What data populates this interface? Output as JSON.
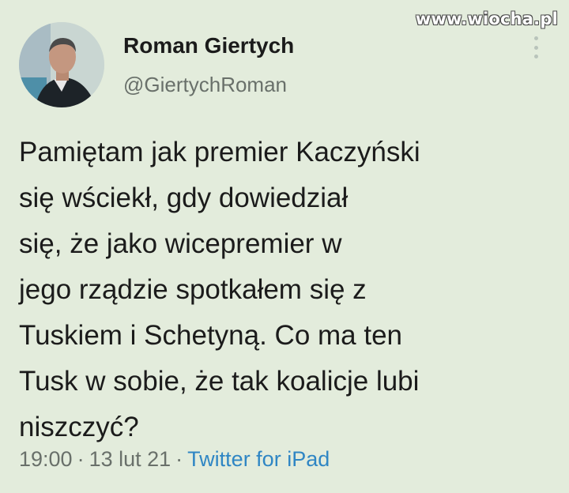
{
  "watermark": "www.wiocha.pl",
  "author": {
    "name": "Roman Giertych",
    "handle": "@GiertychRoman"
  },
  "tweet": {
    "lines": [
      "Pamiętam jak premier Kaczyński",
      "się wściekł, gdy dowiedział",
      "się, że jako wicepremier w",
      "jego rządzie spotkałem się z",
      "Tuskiem i Schetyną. Co ma ten",
      "Tusk w sobie, że tak koalicje lubi",
      "niszczyć?"
    ]
  },
  "meta": {
    "time": "19:00",
    "date": "13 lut 21",
    "separator": "·",
    "source": "Twitter for iPad"
  },
  "icons": {
    "more": "more-vertical-icon",
    "avatar": "profile-photo"
  },
  "colors": {
    "background": "#e3ecdc",
    "text": "#1b1b1b",
    "secondary": "#69706a",
    "link": "#2f86c4"
  }
}
